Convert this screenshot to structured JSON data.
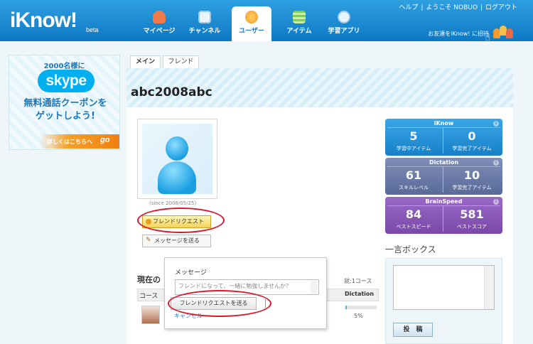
{
  "header": {
    "logo": "iKnow!",
    "logo_suffix": "beta",
    "top_links": [
      "ヘルプ",
      "ようこそ NOBUO",
      "ログアウト"
    ],
    "separator": "|",
    "invite_text": "お友達をiKnow! に招待",
    "nav": [
      {
        "label": "マイページ",
        "icon": "mypage-icon",
        "color": "#f07a4a"
      },
      {
        "label": "チャンネル",
        "icon": "channel-tv-icon",
        "color": "#ffffff"
      },
      {
        "label": "ユーザー",
        "icon": "users-icon",
        "color": "#f6a43a",
        "active": true
      },
      {
        "label": "アイテム",
        "icon": "items-list-icon",
        "color": "#7cd24a"
      },
      {
        "label": "学習アプリ",
        "icon": "app-bubble-icon",
        "color": "#ffffff"
      }
    ]
  },
  "ad": {
    "top": "2000名様に",
    "brand": "skype",
    "main_line1": "無料通話クーポンを",
    "main_line2": "ゲットしよう!",
    "footer": "詳しくはこちらへ",
    "go": "go"
  },
  "tabs": [
    {
      "label": "メイン",
      "active": true
    },
    {
      "label": "フレンド",
      "active": false
    }
  ],
  "profile": {
    "username": "abc2008abc",
    "since": "(since 2008/05/25)",
    "friend_request_button": "フレンドリクエスト",
    "send_message_button": "メッセージを送る"
  },
  "courses": {
    "title": "現在の",
    "count_text": "就:1コース",
    "column_course": "コース",
    "column_dictation": "Dictation",
    "progress_text": "5%",
    "progress": 0.05
  },
  "popup": {
    "title": "メッセージ",
    "message_value": "フレンドになって、一緒に勉強しませんか？",
    "send_button": "フレンドリクエストを送る",
    "cancel": "キャンセル"
  },
  "stats": [
    {
      "title": "iKnow",
      "left_value": "5",
      "left_label": "学習中アイテム",
      "right_value": "0",
      "right_label": "学習完了アイテム",
      "info": "i",
      "color": "#1f86cc"
    },
    {
      "title": "Dictation",
      "left_value": "61",
      "left_label": "スキルレベル",
      "right_value": "10",
      "right_label": "学習完了アイテム",
      "info": "i",
      "color": "#6676a4"
    },
    {
      "title": "BrainSpeed",
      "left_value": "84",
      "left_label": "ベストスピード",
      "right_value": "581",
      "right_label": "ベストスコア",
      "info": "i",
      "color": "#8556b4"
    }
  ],
  "shoutbox": {
    "title": "一言ボックス",
    "submit": "投　稿"
  }
}
